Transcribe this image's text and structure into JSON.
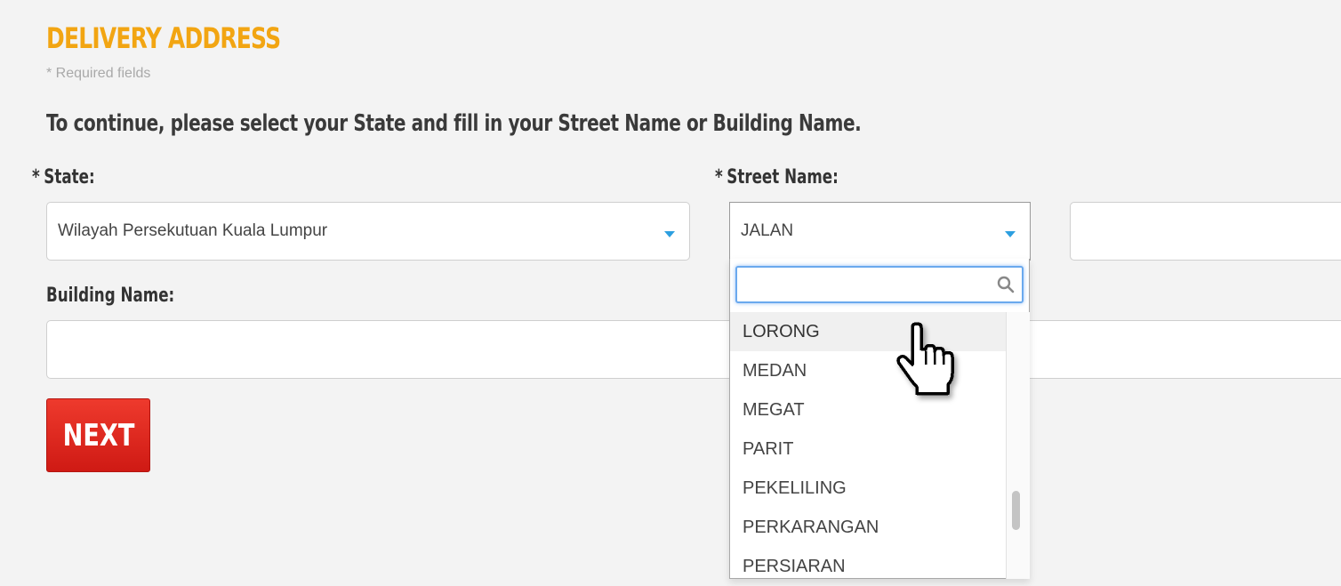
{
  "page": {
    "title": "DELIVERY ADDRESS",
    "required_note": "* Required fields",
    "instruction": "To continue, please select your State and fill in your Street Name or Building Name."
  },
  "state_field": {
    "star": "*",
    "label": "State:",
    "selected": "Wilayah Persekutuan Kuala Lumpur"
  },
  "street_field": {
    "star": "*",
    "label": "Street Name:",
    "selected": "JALAN",
    "search_value": "",
    "options": [
      "LORONG",
      "MEDAN",
      "MEGAT",
      "PARIT",
      "PEKELILING",
      "PERKARANGAN",
      "PERSIARAN"
    ],
    "highlighted_index": 0
  },
  "street_name_input": {
    "value": ""
  },
  "building_field": {
    "label": "Building Name:",
    "value": ""
  },
  "next_button": {
    "label": "NEXT"
  },
  "colors": {
    "title": "#f2a512",
    "caret": "#2d9fe0",
    "next_button": "#e02a20",
    "focus_border": "#6aa9ee"
  },
  "icons": {
    "search": "search-icon",
    "caret": "caret-down-icon",
    "cursor": "hand-pointer-icon"
  }
}
